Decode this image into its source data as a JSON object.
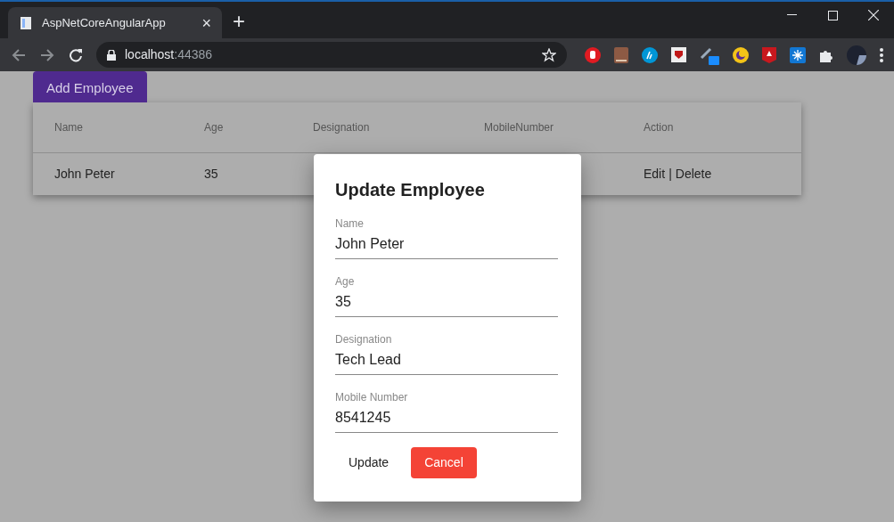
{
  "browser": {
    "tab_title": "AspNetCoreAngularApp",
    "tab_close": "×",
    "new_tab": "+",
    "address_host": "localhost",
    "address_port": ":44386"
  },
  "add_button": "Add Employee",
  "table": {
    "columns": [
      "Name",
      "Age",
      "Designation",
      "MobileNumber",
      "Action"
    ],
    "rows": [
      {
        "name": "John Peter",
        "age": "35",
        "actions": [
          "Edit",
          "Delete"
        ],
        "separator": "|"
      }
    ]
  },
  "dialog": {
    "title": "Update Employee",
    "fields": [
      {
        "label": "Name",
        "value": "John Peter"
      },
      {
        "label": "Age",
        "value": "35"
      },
      {
        "label": "Designation",
        "value": "Tech Lead"
      },
      {
        "label": "Mobile Number",
        "value": "8541245"
      }
    ],
    "buttons": [
      {
        "label": "Update",
        "kind": "text"
      },
      {
        "label": "Cancel",
        "kind": "warn"
      }
    ]
  }
}
